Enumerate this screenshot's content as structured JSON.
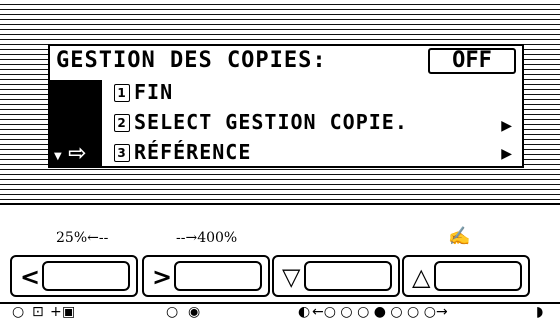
{
  "lcd": {
    "title": "GESTION DES COPIES:",
    "status_value": "OFF",
    "items": [
      {
        "number": "1",
        "label": "FIN",
        "has_submenu": false
      },
      {
        "number": "2",
        "label": "SELECT GESTION COPIE.",
        "has_submenu": true
      },
      {
        "number": "3",
        "label": "RÉFÉRENCE",
        "has_submenu": true
      }
    ],
    "selected_index": 2
  },
  "controls": {
    "zoom_min_label": "25%←--",
    "zoom_max_label": "--→400%",
    "buttons": [
      {
        "name": "zoom-decrease-button",
        "symbol": "<"
      },
      {
        "name": "zoom-increase-button",
        "symbol": ">"
      },
      {
        "name": "scroll-down-button",
        "symbol": "▽"
      },
      {
        "name": "scroll-up-button",
        "symbol": "△"
      }
    ]
  }
}
